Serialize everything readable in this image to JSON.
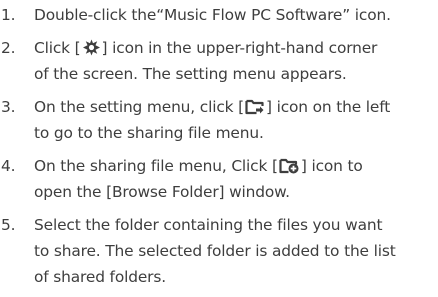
{
  "steps": [
    {
      "number": "1.",
      "lines": [
        "Double-click the“Music Flow PC Software” icon."
      ]
    },
    {
      "number": "2.",
      "a": "Click [",
      "icon": "settings-gear-icon",
      "b": "] icon in the upper-right-hand corner",
      "c": "of the screen. The setting menu appears."
    },
    {
      "number": "3.",
      "a": "On the setting menu, click [",
      "icon": "sharing-folder-icon",
      "b": "] icon on the left",
      "c": "to go to the sharing file menu."
    },
    {
      "number": "4.",
      "a": "On the sharing file menu, Click [",
      "icon": "add-folder-icon",
      "b": "] icon to",
      "c": "open the [Browse Folder] window."
    },
    {
      "number": "5.",
      "lines": [
        "Select the folder containing the files you want",
        "to share. The selected folder is added to the list",
        "of shared folders."
      ]
    }
  ]
}
